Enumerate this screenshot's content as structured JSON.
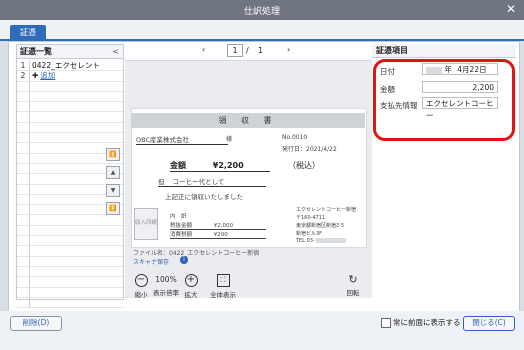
{
  "window": {
    "title": "仕訳処理",
    "close_icon": "close-icon"
  },
  "tabs": [
    {
      "label": "証憑"
    }
  ],
  "left_panel": {
    "header": "証憑一覧",
    "collapse_icon": "chevron-left-icon",
    "rows": [
      {
        "num": "1",
        "label": "0422_エクセレント"
      },
      {
        "num": "2",
        "label": "追加",
        "add_icon": "plus-icon"
      }
    ]
  },
  "viewer": {
    "pager": {
      "prev_icon": "chevron-left-icon",
      "current": "1",
      "separator": "/",
      "total": "1",
      "next_icon": "chevron-right-icon"
    },
    "receipt": {
      "title": "領 収 書",
      "customer": "OBC産業株式会社",
      "honorific": "様",
      "no": "No.0010",
      "date_line": "発行日：2021/4/22",
      "amount_label": "金額",
      "amount": "¥2,200",
      "tax_note": "（税込）",
      "description_prefix": "但",
      "description": "コーヒー代として",
      "received_note": "上記正に領収いたしました",
      "stamp_text": "収入印紙",
      "breakdown_label": "内　訳",
      "subtotal_label": "税抜金額",
      "subtotal": "¥2,000",
      "tax_label": "消費税額",
      "tax": "¥200",
      "shop_name": "エクセレントコーヒー新宿",
      "shop_postal": "〒160-4711",
      "shop_address": "東京都新宿区新宿2-5",
      "shop_address2": "新宿ビル3F",
      "shop_tel": "TEL 03-"
    },
    "file_name": "ファイル名：0422_エクセレントコーヒー新宿",
    "scan_link": "スキャナ保存",
    "info_icon": "info-icon",
    "tools": [
      {
        "label": "縮小",
        "icon": "zoom-out-icon",
        "glyph": "−"
      },
      {
        "label": "表示倍率",
        "value": "100%"
      },
      {
        "label": "拡大",
        "icon": "zoom-in-icon",
        "glyph": "+"
      },
      {
        "label": "全体表示",
        "icon": "fit-icon",
        "glyph": "⛶"
      },
      {
        "label": "回転",
        "icon": "rotate-icon",
        "glyph": "↻"
      }
    ]
  },
  "nav_buttons": [
    {
      "icon": "first-icon",
      "glyph": "⏫"
    },
    {
      "icon": "up-icon",
      "glyph": "▲"
    },
    {
      "icon": "down-icon",
      "glyph": "▼"
    },
    {
      "icon": "last-icon",
      "glyph": "⏬"
    }
  ],
  "right_panel": {
    "header": "証憑項目",
    "fields": [
      {
        "label": "日付",
        "value_year": "年",
        "value": "4月22日"
      },
      {
        "label": "金額",
        "value": "2,200"
      },
      {
        "label": "支払先情報",
        "value": "エクセレントコーヒー"
      }
    ],
    "highlight_color": "#e11414"
  },
  "footer": {
    "delete_button": "削除(D)",
    "always_on_top": "常に前面に表示する",
    "close_button": "閉じる(C)"
  }
}
